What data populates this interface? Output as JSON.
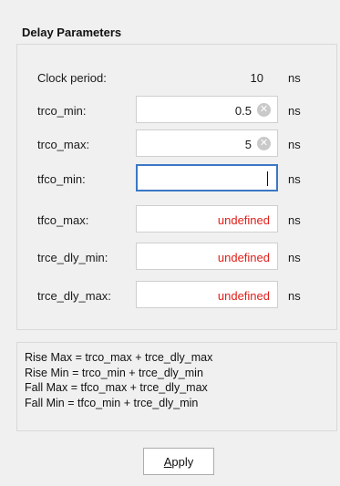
{
  "panel": {
    "title": "Delay Parameters"
  },
  "clock": {
    "label": "Clock period:",
    "value": "10",
    "unit": "ns"
  },
  "fields": [
    {
      "label": "trco_min:",
      "value": "0.5",
      "unit": "ns",
      "state": "filled"
    },
    {
      "label": "trco_max:",
      "value": "5",
      "unit": "ns",
      "state": "filled"
    },
    {
      "label": "tfco_min:",
      "value": "",
      "unit": "ns",
      "state": "focused"
    },
    {
      "label": "tfco_max:",
      "value": "undefined",
      "unit": "ns",
      "state": "undefined"
    },
    {
      "label": "trce_dly_min:",
      "value": "undefined",
      "unit": "ns",
      "state": "undefined"
    },
    {
      "label": "trce_dly_max:",
      "value": "undefined",
      "unit": "ns",
      "state": "undefined"
    }
  ],
  "formulas": [
    "Rise Max = trco_max + trce_dly_max",
    "Rise Min = trco_min + trce_dly_min",
    "Fall Max = tfco_max + trce_dly_max",
    "Fall Min = tfco_min + trce_dly_min"
  ],
  "apply_button": {
    "mnemonic": "A",
    "rest": "pply"
  },
  "colors": {
    "undefined_text": "#e0201a",
    "focus_border": "#3b78c4"
  }
}
